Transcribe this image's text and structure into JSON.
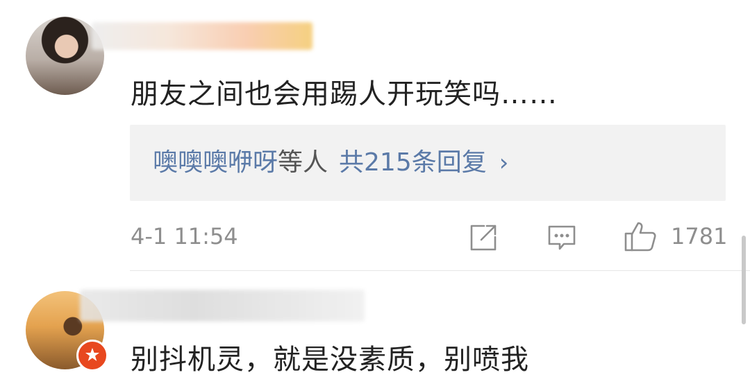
{
  "comments": [
    {
      "text": "朋友之间也会用踢人开玩笑吗……",
      "replies": {
        "names": "噢噢噢咿呀",
        "etc": "等人",
        "count_text": "共215条回复",
        "chevron": "›"
      },
      "timestamp": "4-1 11:54",
      "likes": "1781"
    },
    {
      "text": "别抖机灵，就是没素质，别喷我"
    }
  ],
  "icons": {
    "share": "share-icon",
    "comment": "comment-icon",
    "like": "thumbs-up-icon",
    "badge": "verified-badge-icon"
  },
  "colors": {
    "link": "#5b7aa8",
    "meta": "#8e8e8e",
    "text": "#222222",
    "reply_bg": "#f2f2f2"
  }
}
